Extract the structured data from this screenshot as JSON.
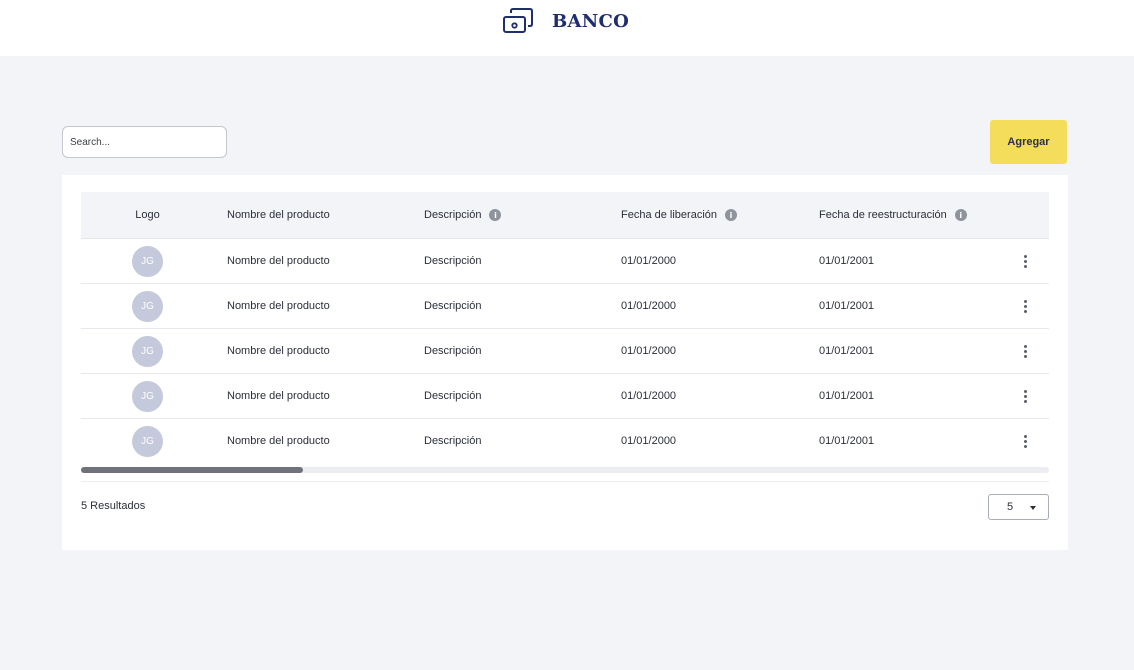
{
  "brand": {
    "name": "BANCO",
    "icon": "bank-card-icon",
    "color": "#1f2f6e"
  },
  "toolbar": {
    "search_placeholder": "Search...",
    "add_label": "Agregar",
    "accent": "#f4dd5b"
  },
  "table": {
    "headers": {
      "logo": "Logo",
      "name": "Nombre del producto",
      "description": "Descripción",
      "release_date": "Fecha de liberación",
      "restructure_date": "Fecha de reestructuración"
    },
    "info_icon": "i",
    "rows": [
      {
        "avatar": "JG",
        "name": "Nombre del producto",
        "description": "Descripción",
        "release_date": "01/01/2000",
        "restructure_date": "01/01/2001"
      },
      {
        "avatar": "JG",
        "name": "Nombre del producto",
        "description": "Descripción",
        "release_date": "01/01/2000",
        "restructure_date": "01/01/2001"
      },
      {
        "avatar": "JG",
        "name": "Nombre del producto",
        "description": "Descripción",
        "release_date": "01/01/2000",
        "restructure_date": "01/01/2001"
      },
      {
        "avatar": "JG",
        "name": "Nombre del producto",
        "description": "Descripción",
        "release_date": "01/01/2000",
        "restructure_date": "01/01/2001"
      },
      {
        "avatar": "JG",
        "name": "Nombre del producto",
        "description": "Descripción",
        "release_date": "01/01/2000",
        "restructure_date": "01/01/2001"
      }
    ]
  },
  "footer": {
    "results_label": "5 Resultados",
    "per_page": "5"
  }
}
